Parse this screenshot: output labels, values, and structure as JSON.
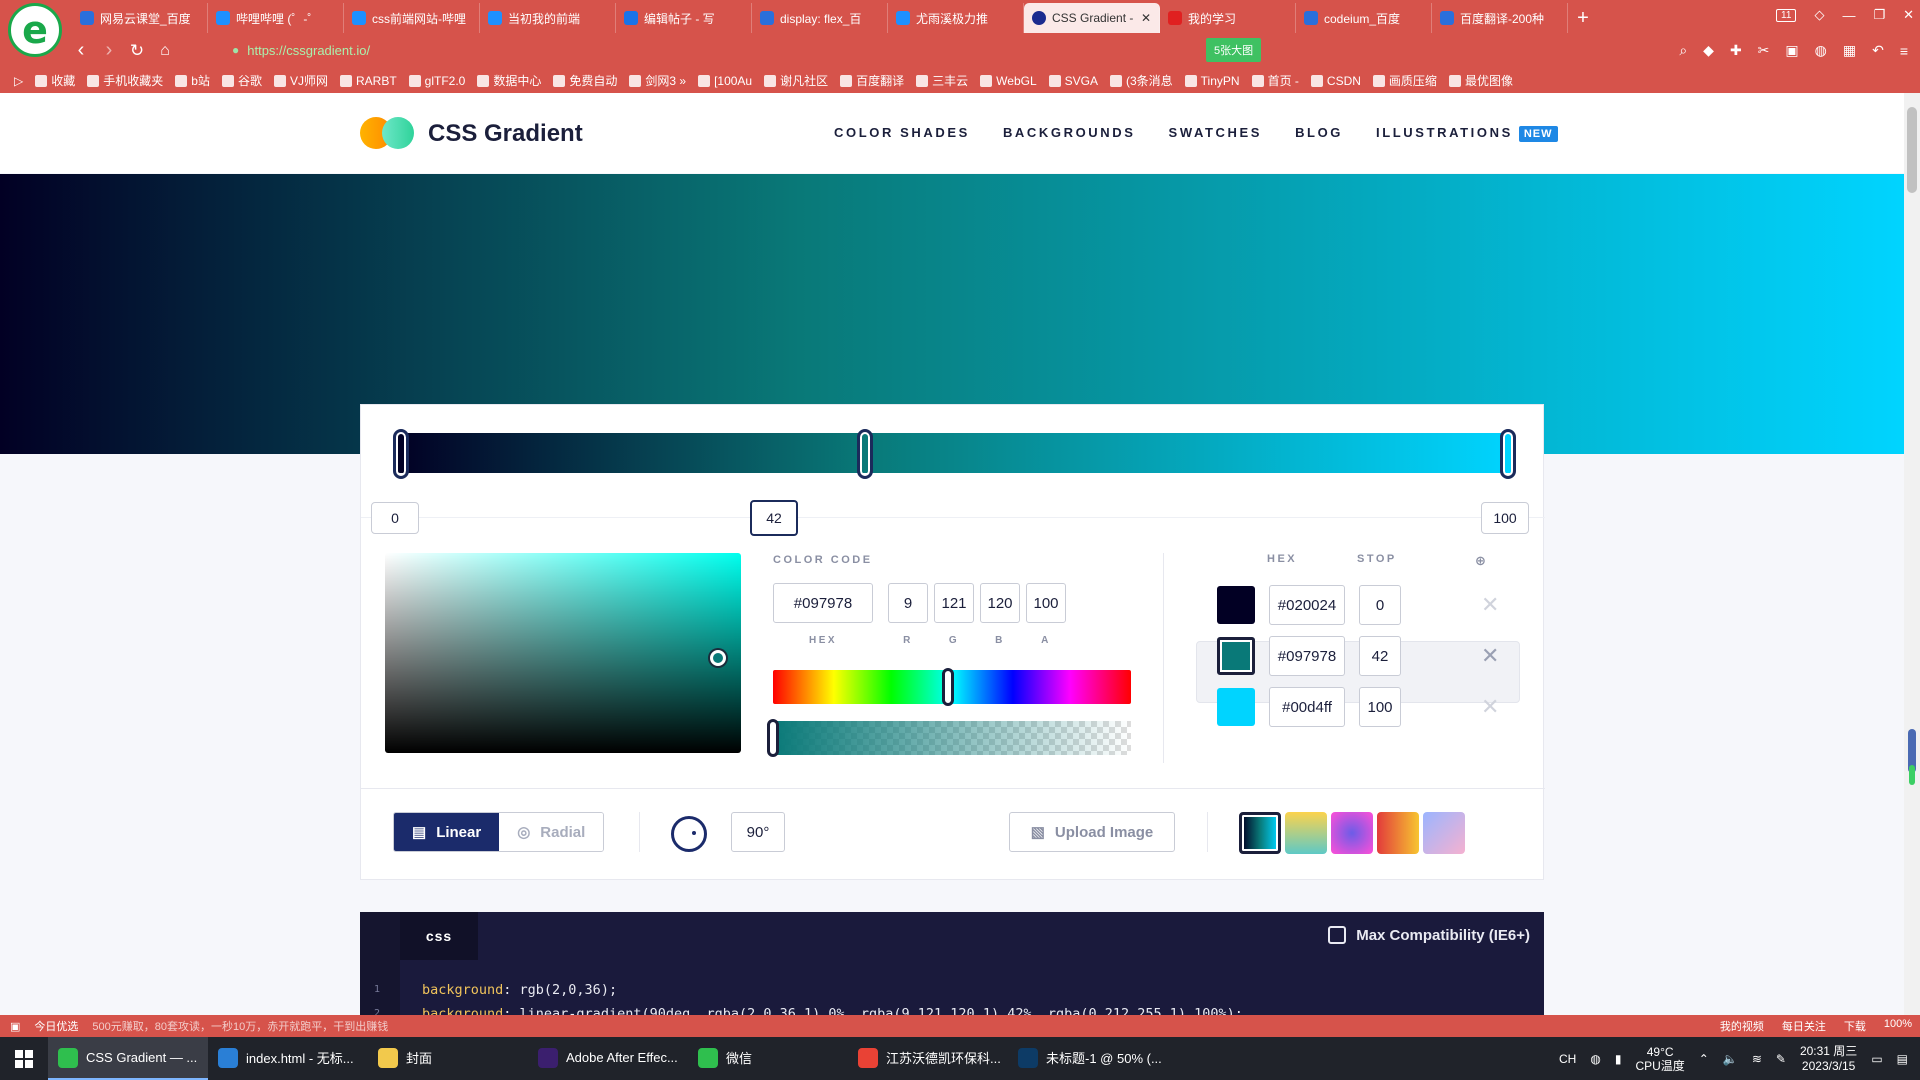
{
  "browser": {
    "tabs": [
      {
        "label": "网易云课堂_百度",
        "icon_color": "#2a6fdb",
        "active": false
      },
      {
        "label": "哔哩哔哩 (゜-゜",
        "icon_color": "#1e90ff",
        "active": false
      },
      {
        "label": "css前端网站-哔哩",
        "icon_color": "#1e90ff",
        "active": false
      },
      {
        "label": "当初我的前端",
        "icon_color": "#1e90ff",
        "active": false
      },
      {
        "label": "编辑帖子 - 写",
        "icon_color": "#1a73e8",
        "active": false
      },
      {
        "label": "display: flex_百",
        "icon_color": "#2a6fdb",
        "active": false
      },
      {
        "label": "尤雨溪极力推",
        "icon_color": "#1e90ff",
        "active": false
      },
      {
        "label": "CSS Gradient -",
        "icon_color": "#1b2b8f",
        "active": true
      },
      {
        "label": "我的学习",
        "icon_color": "#e02020",
        "active": false
      },
      {
        "label": "codeium_百度",
        "icon_color": "#2a6fdb",
        "active": false
      },
      {
        "label": "百度翻译-200种",
        "icon_color": "#2a6fdb",
        "active": false
      }
    ],
    "tab_count": "11",
    "url": "https://cssgradient.io/",
    "green_pill": "5张大图",
    "bookmarks": [
      "收藏",
      "手机收藏夹",
      "b站",
      "谷歌",
      "VJ师网",
      "RARBT",
      "glTF2.0",
      "数据中心",
      "免费自动",
      "剑网3 »",
      "[100Au",
      "谢凡社区",
      "百度翻译",
      "三丰云",
      "WebGL",
      "SVGA",
      "(3条消息",
      "TinyPN",
      "首页 -",
      "CSDN",
      "画质压缩",
      "最优图像"
    ]
  },
  "site": {
    "brand": "CSS Gradient",
    "nav": [
      "COLOR SHADES",
      "BACKGROUNDS",
      "SWATCHES",
      "BLOG",
      "ILLUSTRATIONS"
    ],
    "nav_badge": "NEW",
    "accent": "#1e88e5"
  },
  "editor": {
    "gradient_colors": [
      "#020024",
      "#097978",
      "#00d4ff"
    ],
    "stop_positions": [
      "0",
      "42",
      "100"
    ],
    "selected_stop": "42",
    "color_code_title": "COLOR CODE",
    "hex": "#097978",
    "r": "9",
    "g": "121",
    "b": "120",
    "a": "100",
    "labels": {
      "hex": "HEX",
      "r": "R",
      "g": "G",
      "b": "B",
      "a": "A"
    },
    "hue_level": 0.49,
    "stops_table": {
      "hex_header": "HEX",
      "stop_header": "STOP",
      "rows": [
        {
          "hex": "#020024",
          "stop": "0",
          "color": "#020024"
        },
        {
          "hex": "#097978",
          "stop": "42",
          "color": "#097978"
        },
        {
          "hex": "#00d4ff",
          "stop": "100",
          "color": "#00d4ff"
        }
      ]
    },
    "type_linear": "Linear",
    "type_radial": "Radial",
    "angle": "90°",
    "upload_label": "Upload Image"
  },
  "code": {
    "tab": "css",
    "max_compat": "Max Compatibility (IE6+)",
    "line1_prop": "background",
    "line1_val": ": rgb(2,0,36);",
    "line2_prop": "background",
    "line2_val": ": linear-gradient(90deg, rgba(2,0,36,1) 0%, rgba(9,121,120,1) 42%, rgba(0,212,255,1) 100%);"
  },
  "statusbar": {
    "left": "今日优选",
    "ticker": "500元赚取，80套攻读，一秒10万，赤开就跑平，干到出赚钱",
    "items": [
      "我的视频",
      "每日关注",
      "下载",
      "100%"
    ]
  },
  "taskbar": {
    "apps": [
      {
        "label": "CSS Gradient — ...",
        "color": "#2fbf4e",
        "active": true
      },
      {
        "label": "index.html - 无标...",
        "color": "#2a7fd6",
        "active": false
      },
      {
        "label": "封面",
        "color": "#f2c94c",
        "active": false
      },
      {
        "label": "Adobe After Effec...",
        "color": "#3b1f6e",
        "active": false
      },
      {
        "label": "微信",
        "color": "#2fbf4e",
        "active": false
      },
      {
        "label": "江苏沃德凯环保科...",
        "color": "#e94235",
        "active": false
      },
      {
        "label": "未标题-1 @ 50% (...",
        "color": "#0d3b66",
        "active": false
      }
    ],
    "lang": "CH",
    "temp": "49°C",
    "temp_label": "CPU温度",
    "time": "20:31 周三",
    "date": "2023/3/15"
  }
}
